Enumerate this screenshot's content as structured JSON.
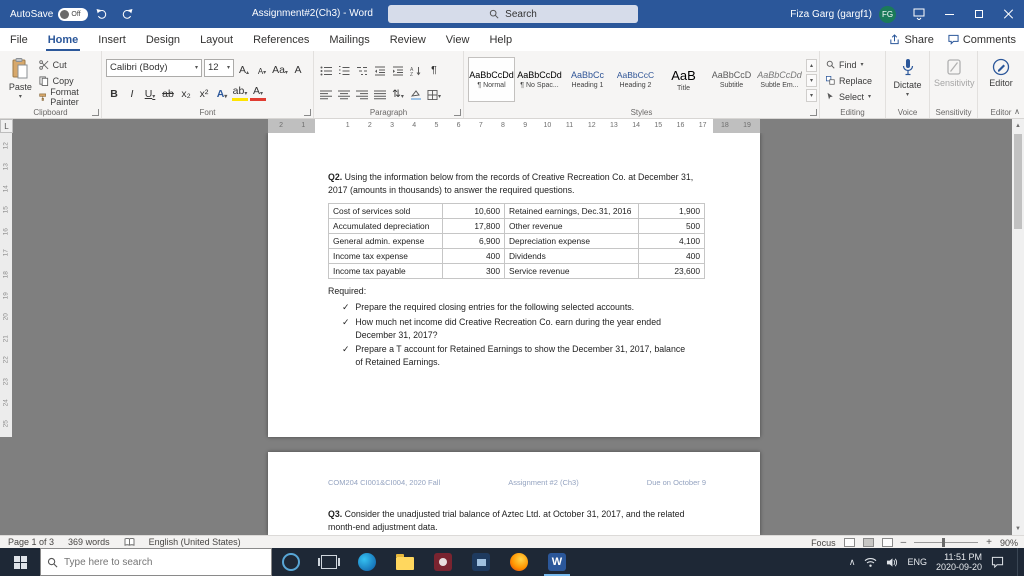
{
  "colors": {
    "accent": "#2b579a",
    "titlebar": "#2b579a",
    "taskbar": "#1e2836",
    "doc_background": "#7f7f7f",
    "avatar": "#1b7a5a",
    "heading_style": "#2f5496"
  },
  "titlebar": {
    "autosave_label": "AutoSave",
    "autosave_state": "Off",
    "title": "Assignment#2(Ch3) - Word",
    "search_placeholder": "Search",
    "user_name": "Fiza Garg (gargf1)",
    "user_initials": "FG"
  },
  "ribbon": {
    "tabs": [
      {
        "label": "File"
      },
      {
        "label": "Home"
      },
      {
        "label": "Insert"
      },
      {
        "label": "Design"
      },
      {
        "label": "Layout"
      },
      {
        "label": "References"
      },
      {
        "label": "Mailings"
      },
      {
        "label": "Review"
      },
      {
        "label": "View"
      },
      {
        "label": "Help"
      }
    ],
    "active_tab": "Home",
    "share_label": "Share",
    "comments_label": "Comments",
    "clipboard": {
      "group_label": "Clipboard",
      "paste_label": "Paste",
      "cut_label": "Cut",
      "copy_label": "Copy",
      "format_painter_label": "Format Painter"
    },
    "font": {
      "group_label": "Font",
      "font_name": "Calibri (Body)",
      "font_size": "12",
      "bold": "B",
      "italic": "I",
      "underline": "U",
      "strikethrough": "ab",
      "subscript": "x₂",
      "superscript": "x²",
      "grow": "A",
      "shrink": "A",
      "change_case": "Aa",
      "clear_format": "A",
      "effects": "A",
      "highlight": "ab",
      "color": "A"
    },
    "paragraph": {
      "group_label": "Paragraph"
    },
    "styles": {
      "group_label": "Styles",
      "items": [
        {
          "preview": "AaBbCcDd",
          "name": "¶ Normal"
        },
        {
          "preview": "AaBbCcDd",
          "name": "¶ No Spac..."
        },
        {
          "preview": "AaBbCc",
          "name": "Heading 1"
        },
        {
          "preview": "AaBbCcC",
          "name": "Heading 2"
        },
        {
          "preview": "AaB",
          "name": "Title"
        },
        {
          "preview": "AaBbCcD",
          "name": "Subtitle"
        },
        {
          "preview": "AaBbCcDd",
          "name": "Subtle Em..."
        }
      ]
    },
    "editing": {
      "group_label": "Editing",
      "find_label": "Find",
      "replace_label": "Replace",
      "select_label": "Select"
    },
    "voice": {
      "group_label": "Voice",
      "dictate_label": "Dictate"
    },
    "sensitivity": {
      "group_label": "Sensitivity",
      "button_label": "Sensitivity"
    },
    "editor_group": {
      "group_label": "Editor",
      "button_label": "Editor"
    }
  },
  "icons": {
    "caret_down": "▾",
    "caret_up": "▴",
    "scroll_up": "▲",
    "scroll_down": "▼",
    "chevron_up": "∧",
    "check": "✓",
    "pilcrow": "¶",
    "line_spacing": "⇅",
    "tab_selector": "L",
    "zoom_out": "–",
    "zoom_in": "+"
  },
  "ruler": {
    "h_numbers": [
      "2",
      "1",
      "",
      "1",
      "2",
      "3",
      "4",
      "5",
      "6",
      "7",
      "8",
      "9",
      "10",
      "11",
      "12",
      "13",
      "14",
      "15",
      "16",
      "17",
      "18",
      "19"
    ],
    "v_numbers": [
      "12",
      "13",
      "14",
      "15",
      "16",
      "17",
      "18",
      "19",
      "20",
      "21",
      "22",
      "23",
      "24",
      "25"
    ]
  },
  "doc": {
    "q2_label": "Q2.",
    "q2_text": "Using the information below from the records of Creative Recreation Co. at December 31, 2017 (amounts in thousands) to answer the required questions.",
    "table": [
      [
        "Cost of services sold",
        "10,600",
        "Retained earnings, Dec.31, 2016",
        "1,900"
      ],
      [
        "Accumulated depreciation",
        "17,800",
        "Other revenue",
        "500"
      ],
      [
        "General admin. expense",
        "6,900",
        "Depreciation expense",
        "4,100"
      ],
      [
        "Income tax expense",
        "400",
        "Dividends",
        "400"
      ],
      [
        "Income tax payable",
        "300",
        "Service revenue",
        "23,600"
      ]
    ],
    "required_label": "Required:",
    "checklist": [
      "Prepare the required closing entries for the following selected accounts.",
      "How much net income did Creative Recreation Co. earn during the year ended December 31, 2017?",
      "Prepare a T account for Retained Earnings to show the December 31, 2017, balance of Retained Earnings."
    ],
    "page2_header_left": "COM204 CI001&CI004, 2020 Fall",
    "page2_header_center": "Assignment #2 (Ch3)",
    "page2_header_right": "Due on October 9",
    "q3_label": "Q3.",
    "q3_text": "Consider the unadjusted trial balance of Aztec Ltd. at October 31, 2017, and the related month-end adjustment data."
  },
  "statusbar": {
    "page_info": "Page 1 of 3",
    "word_count": "369 words",
    "language": "English (United States)",
    "focus_label": "Focus",
    "zoom_level": "90%"
  },
  "taskbar": {
    "search_placeholder": "Type here to search",
    "language": "ENG",
    "time": "11:51 PM",
    "date": "2020-09-20"
  }
}
